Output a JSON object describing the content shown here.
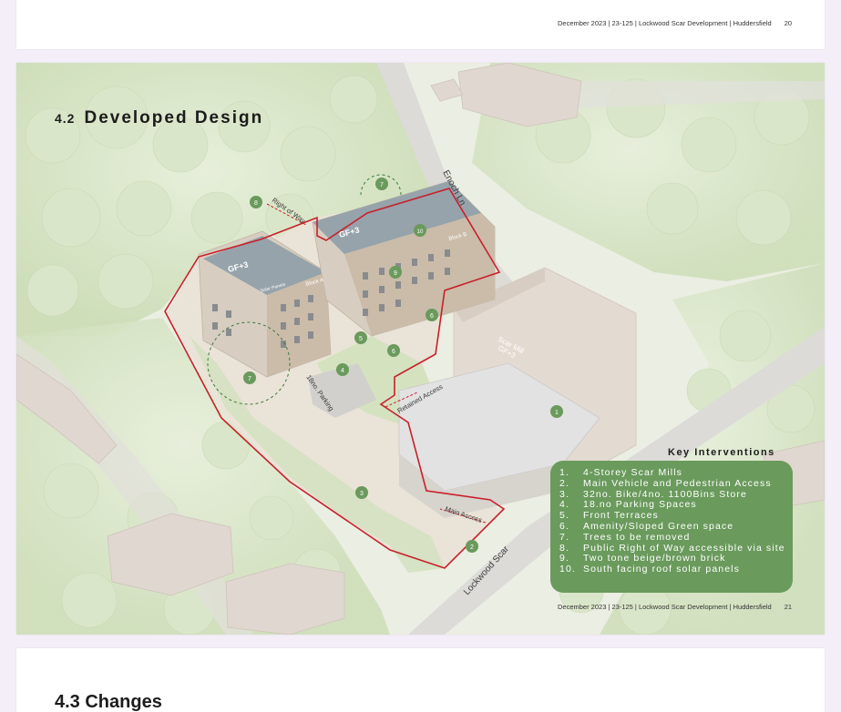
{
  "page_top": {
    "footer": "December 2023 | 23-125 | Lockwood Scar Development | Huddersfield",
    "page_number": "20"
  },
  "section": {
    "number": "4.2",
    "title": "Developed Design"
  },
  "map": {
    "streets": [
      "Enoch Ln",
      "Lockwood Scar"
    ],
    "labels": {
      "right_of_way": "Right of Way",
      "retained_access": "Retained Access",
      "main_access": "Main Access",
      "parking": "18no. Parking",
      "block_a": "Block A",
      "block_b": "Block B",
      "block_a_storeys": "GF+3",
      "block_b_storeys": "GF+3",
      "scar_mill": "Scar Mill",
      "scar_mill_storeys": "GF+3",
      "solar_panels": "Solar Panels"
    },
    "markers": [
      {
        "n": "1"
      },
      {
        "n": "2"
      },
      {
        "n": "3"
      },
      {
        "n": "4"
      },
      {
        "n": "5"
      },
      {
        "n": "6"
      },
      {
        "n": "6"
      },
      {
        "n": "7"
      },
      {
        "n": "7"
      },
      {
        "n": "8"
      },
      {
        "n": "9"
      },
      {
        "n": "10"
      }
    ],
    "colors": {
      "boundary": "#c8202a",
      "marker": "#6a9a5c",
      "green_space": "#cbdcb2",
      "building": "#d9cfc2"
    }
  },
  "key": {
    "heading": "Key Interventions",
    "items": [
      {
        "num": "1.",
        "text": "4-Storey Scar Mills"
      },
      {
        "num": "2.",
        "text": "Main Vehicle and Pedestrian Access"
      },
      {
        "num": "3.",
        "text": "32no. Bike/4no. 1100Bins Store"
      },
      {
        "num": "4.",
        "text": "18.no Parking Spaces"
      },
      {
        "num": "5.",
        "text": "Front Terraces"
      },
      {
        "num": "6.",
        "text": "Amenity/Sloped Green space"
      },
      {
        "num": "7.",
        "text": "Trees to be removed"
      },
      {
        "num": "8.",
        "text": "Public Right of Way accessible via site"
      },
      {
        "num": "9.",
        "text": "Two tone beige/brown brick"
      },
      {
        "num": "10.",
        "text": "South facing roof solar panels"
      }
    ]
  },
  "page_main": {
    "footer": "December 2023 | 23-125 | Lockwood Scar Development | Huddersfield",
    "page_number": "21"
  },
  "page_bottom": {
    "title": "4.3 Changes"
  }
}
